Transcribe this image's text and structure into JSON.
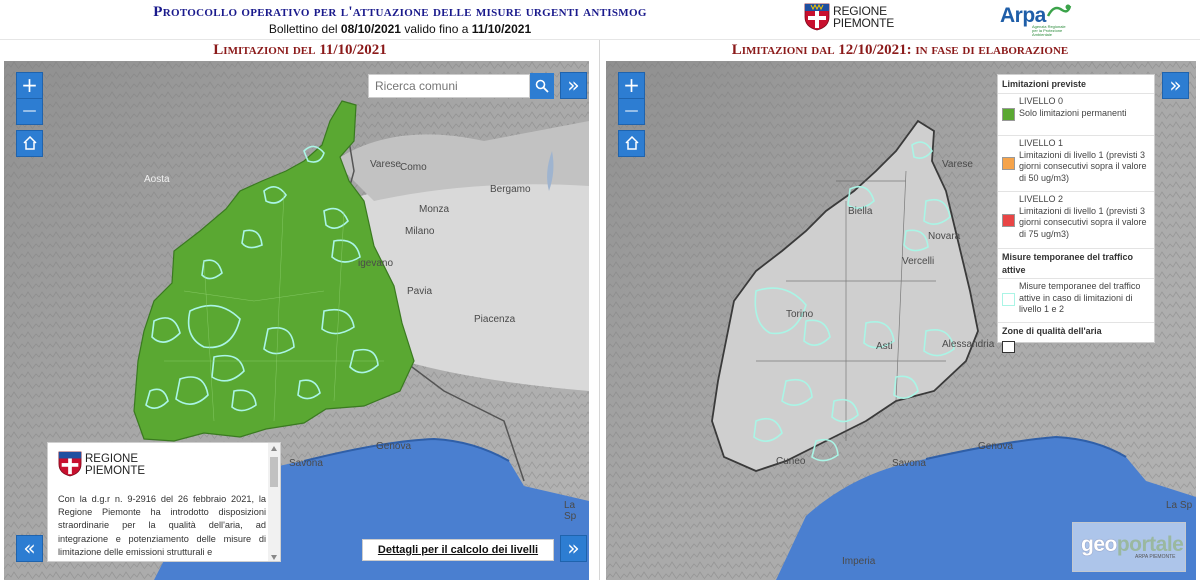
{
  "header": {
    "title": "Protocollo operativo per l'attuazione delle misure urgenti antismog",
    "bulletin_prefix": "Bollettino del",
    "bulletin_date": "08/10/2021",
    "bulletin_mid": "valido fino a",
    "bulletin_valid_until": "11/10/2021",
    "regione_logo_line1": "REGIONE",
    "regione_logo_line2": "PIEMONTE",
    "arpa_logo": "Arpa",
    "arpa_logo_sub": "Agenzia Regionale per la Protezione Ambientale"
  },
  "left_panel": {
    "title": "Limitazioni del 11/10/2021",
    "search_placeholder": "Ricerca comuni",
    "zoom_in": "+",
    "zoom_out": "—",
    "expand": "»",
    "collapse": "«",
    "places": {
      "varese": "Varese",
      "como": "Como",
      "bergamo": "Bergamo",
      "aosta": "Aosta",
      "monza": "Monza",
      "milano": "Milano",
      "vigevano": "igevano",
      "pavia": "Pavia",
      "piacenza": "Piacenza",
      "genova": "Genova",
      "savona": "Savona",
      "lasp": "La Sp"
    },
    "info_popup": {
      "logo_line1": "REGIONE",
      "logo_line2": "PIEMONTE",
      "text": "Con la d.g.r n. 9-2916 del 26 febbraio 2021, la Regione Piemonte ha introdotto disposizioni straordinarie per la qualità dell'aria, ad integrazione e potenziamento delle misure di limitazione delle emissioni strutturali e"
    },
    "details_link": "Dettagli per il calcolo dei livelli"
  },
  "right_panel": {
    "title": "Limitazioni dal 12/10/2021: in fase di elaborazione",
    "zoom_in": "+",
    "zoom_out": "—",
    "expand": "»",
    "places": {
      "varese": "Varese",
      "biella": "Biella",
      "novara": "Novara",
      "vercelli": "Vercelli",
      "torino": "Torino",
      "asti": "Asti",
      "alessandria": "Alessandria",
      "cuneo": "Cuneo",
      "genova": "Genova",
      "savona": "Savona",
      "imperia": "Imperia",
      "lasp": "La Sp"
    },
    "legend": {
      "heading_limits": "Limitazioni previste",
      "level0_title": "LIVELLO 0",
      "level0_desc": "Solo limitazioni permanenti",
      "level0_color": "#5aa832",
      "level1_title": "LIVELLO 1",
      "level1_desc": "Limitazioni di livello 1 (previsti 3 giorni consecutivi sopra il valore di 50 ug/m3)",
      "level1_color": "#f5a34a",
      "level2_title": "LIVELLO 2",
      "level2_desc": "Limitazioni di livello 1 (previsti 3 giorni consecutivi sopra il valore di 75 ug/m3)",
      "level2_color": "#e84545",
      "heading_temp": "Misure temporanee del traffico attive",
      "temp_desc": "Misure temporanee del traffico attive in caso di limitazioni di livello 1 e 2",
      "temp_color": "#aaf5e6",
      "heading_zones": "Zone di qualità dell'aria"
    },
    "geoportale_word_a": "geo",
    "geoportale_word_b": "portale",
    "geoportale_sub": "ARPA PIEMONTE"
  },
  "colors": {
    "title_blue": "#1a1a8c",
    "panel_title_red": "#8b1a1a",
    "button_blue": "#2d7dd2",
    "green_fill": "#5aa832",
    "sea_blue": "#4a7fd0"
  }
}
